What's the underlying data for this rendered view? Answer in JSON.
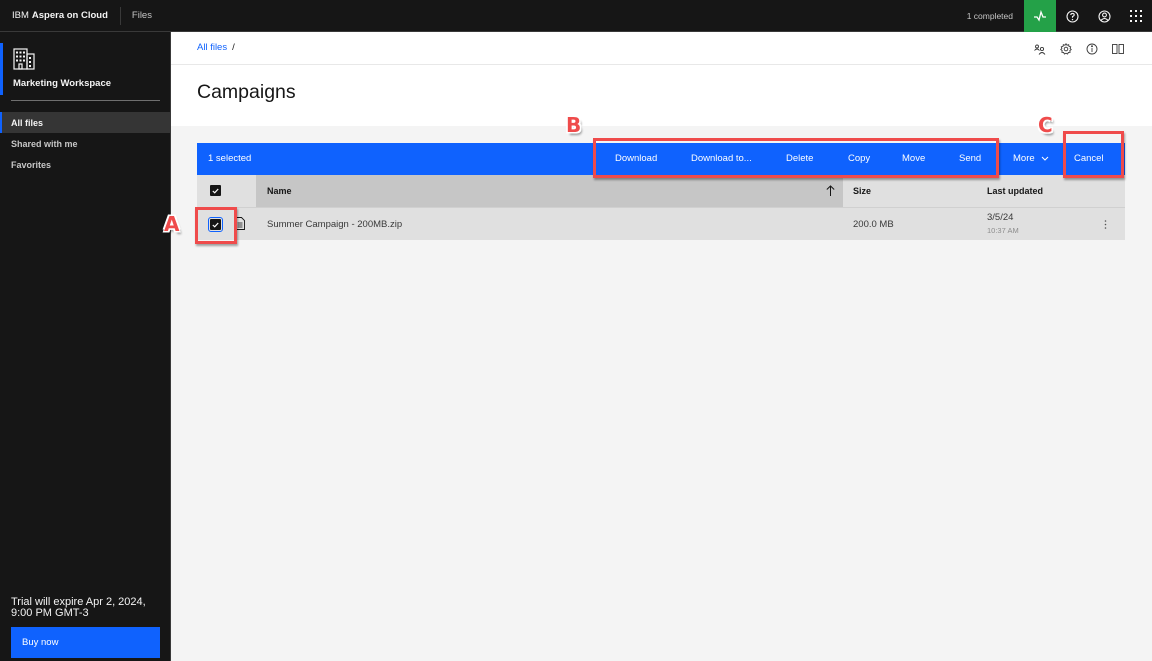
{
  "header": {
    "brand_prefix": "IBM",
    "brand_name": "Aspera on Cloud",
    "app_name": "Files",
    "transfer_status": "1 completed",
    "icons": [
      "activity-icon",
      "help-icon",
      "user-avatar-icon",
      "app-switcher-icon"
    ],
    "activity_color": "#24a148"
  },
  "sidebar": {
    "workspace_icon": "building-icon",
    "workspace_name": "Marketing Workspace",
    "items": [
      {
        "label": "All files",
        "active": true
      },
      {
        "label": "Shared with me",
        "active": false
      },
      {
        "label": "Favorites",
        "active": false
      }
    ],
    "trial_text": "Trial will expire Apr 2, 2024, 9:00 PM GMT-3",
    "buy_label": "Buy now"
  },
  "breadcrumb": {
    "items": [
      {
        "label": "All files"
      }
    ],
    "separator": "/"
  },
  "utility_icons": [
    "manage-users-icon",
    "settings-icon",
    "info-icon",
    "split-view-icon"
  ],
  "page": {
    "title": "Campaigns"
  },
  "action_bar": {
    "selected_text": "1 selected",
    "actions": [
      {
        "label": "Download"
      },
      {
        "label": "Download to..."
      },
      {
        "label": "Delete"
      },
      {
        "label": "Copy"
      },
      {
        "label": "Move"
      },
      {
        "label": "Send"
      }
    ],
    "more_label": "More",
    "cancel_label": "Cancel",
    "color": "#0f62fe"
  },
  "table": {
    "columns": [
      {
        "label": "Name",
        "sorted": "ascending"
      },
      {
        "label": "Size"
      },
      {
        "label": "Last updated"
      }
    ],
    "rows": [
      {
        "selected": true,
        "icon": "document-icon",
        "name": "Summer Campaign - 200MB.zip",
        "size": "200.0 MB",
        "date": "3/5/24",
        "time": "10:37 AM"
      }
    ]
  },
  "annotations": [
    {
      "label": "A",
      "target": "row-checkbox"
    },
    {
      "label": "B",
      "target": "bulk-actions"
    },
    {
      "label": "C",
      "target": "cancel-button"
    }
  ]
}
